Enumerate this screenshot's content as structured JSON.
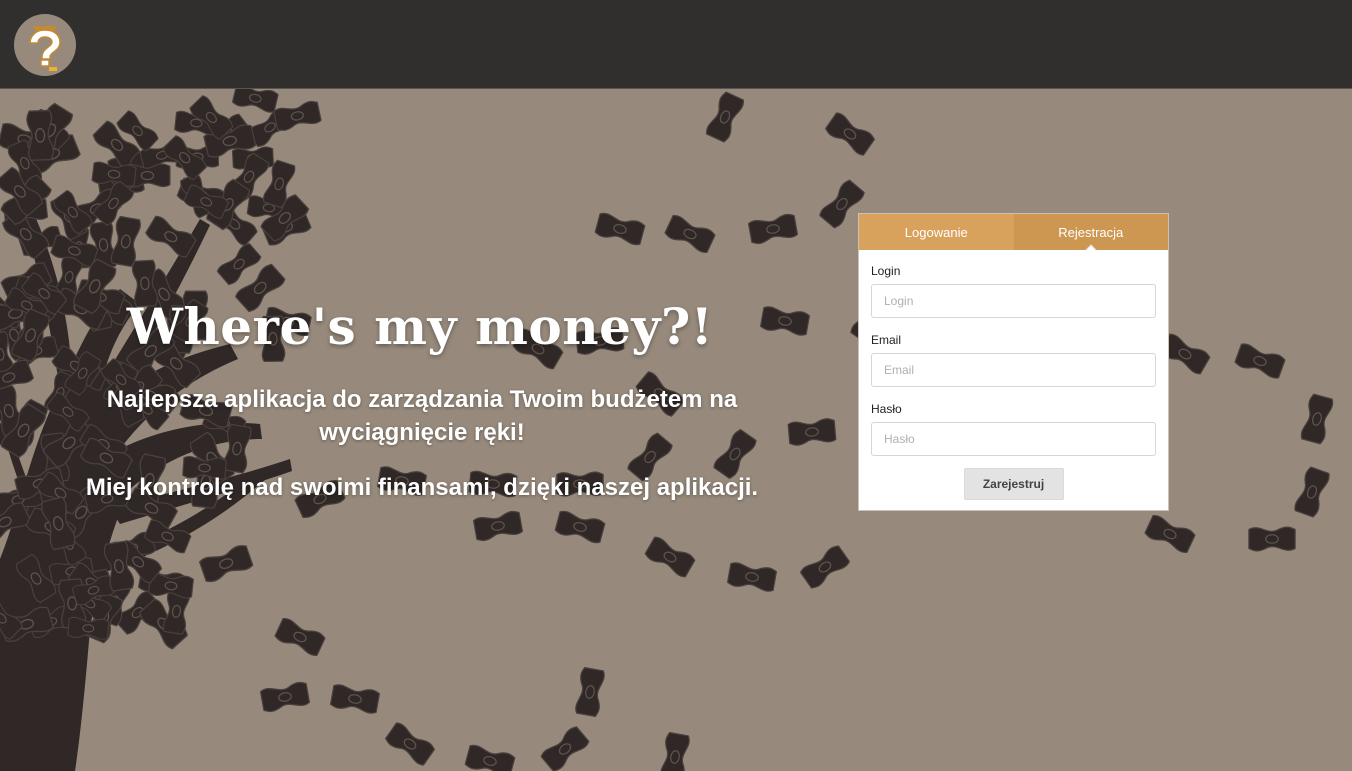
{
  "header": {
    "logo_icon": "question-mark-bag-icon"
  },
  "hero": {
    "headline": "Where's my money?!",
    "tagline_1": "Najlepsza aplikacja do zarządzania Twoim budżetem na wyciągnięcie ręki!",
    "tagline_2": "Miej kontrolę nad swoimi finansami, dzięki naszej aplikacji."
  },
  "auth_panel": {
    "tabs": [
      {
        "label": "Logowanie",
        "active": false
      },
      {
        "label": "Rejestracja",
        "active": true
      }
    ],
    "fields": [
      {
        "label": "Login",
        "placeholder": "Login",
        "value": ""
      },
      {
        "label": "Email",
        "placeholder": "Email",
        "value": ""
      },
      {
        "label": "Hasło",
        "placeholder": "Hasło",
        "value": ""
      }
    ],
    "submit_label": "Zarejestruj"
  },
  "colors": {
    "page_bg": "#978a7c",
    "topbar_bg": "#302f2e",
    "accent": "#d9a25c",
    "tree": "#2f2827"
  }
}
